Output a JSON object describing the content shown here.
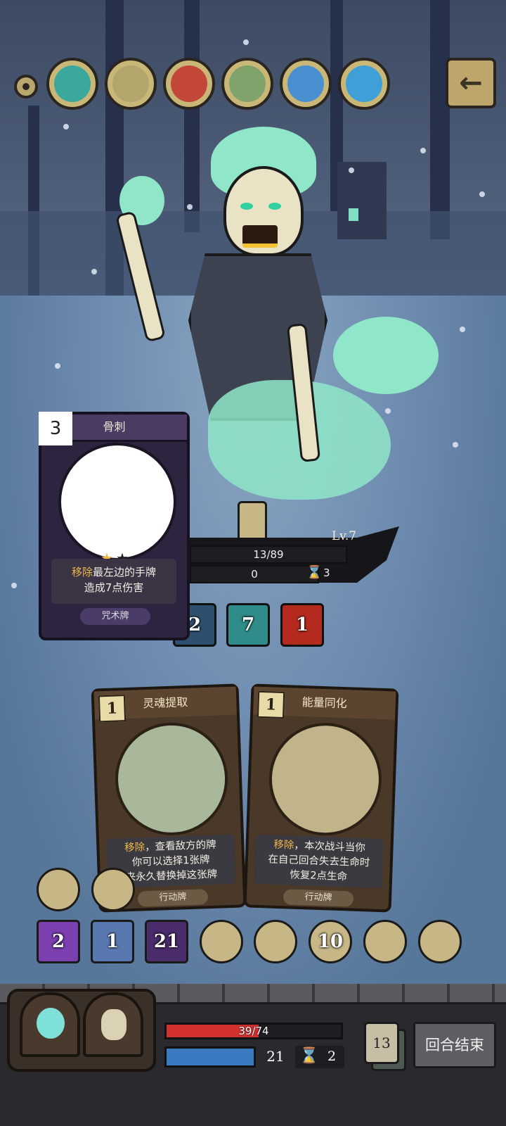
{
  "relic_bar": {
    "relics": [
      {
        "icon": "red-flower-relic-icon",
        "color": "#3aa89c"
      },
      {
        "icon": "fist-relic-icon",
        "color": "#b2a66c"
      },
      {
        "icon": "red-blue-swirl-relic-icon",
        "color": "#c4483a"
      },
      {
        "icon": "green-spirit-relic-icon",
        "color": "#7fa36b"
      },
      {
        "icon": "blue-wind-relic-icon",
        "color": "#4a8fd0"
      },
      {
        "icon": "blue-dragon-relic-icon",
        "color": "#3fa0d8"
      }
    ]
  },
  "enemy": {
    "level": "Lv.7",
    "hp": "13/89",
    "shield": "0",
    "turns": "3",
    "intents": [
      {
        "value": "2",
        "icon": "claw-slash-icon",
        "color": "#2e4f6e"
      },
      {
        "value": "7",
        "icon": "armor-shirt-icon",
        "color": "#2f8c88"
      },
      {
        "value": "1",
        "icon": "red-demon-icon",
        "color": "#b52a1e"
      }
    ]
  },
  "enemy_card": {
    "cost": "3",
    "title": "骨刺",
    "desc_highlight": "移除",
    "desc_line1": "最左边的手牌",
    "desc_line2": "造成7点伤害",
    "type": "咒术牌",
    "stars": 1,
    "stars_max": 2
  },
  "hand": [
    {
      "cost": "1",
      "title": "灵魂提取",
      "hl": "移除",
      "line1": "，查看敌方的牌",
      "line2": "你可以选择1张牌",
      "line3": "来永久替换掉这张牌",
      "type": "行动牌"
    },
    {
      "cost": "1",
      "title": "能量同化",
      "hl": "移除",
      "line1": "，本次战斗当你",
      "line2": "在自己回合失去生命时",
      "line3": "恢复2点生命",
      "type": "行动牌"
    }
  ],
  "buffs": [
    {
      "value": "2",
      "icon": "purple-eye-icon",
      "color": "#7b3fb0"
    },
    {
      "value": "1",
      "icon": "hooded-figure-icon",
      "color": "#5a78b0"
    },
    {
      "value": "21",
      "icon": "purple-shadow-icon",
      "color": "#4a2c6a"
    },
    {
      "value": "",
      "icon": "witch-relic-icon",
      "color": "#c7b787"
    },
    {
      "value": "",
      "icon": "chest-relic-icon",
      "color": "#c7b787"
    },
    {
      "value": "10",
      "icon": "treasure-relic-icon",
      "color": "#c7b787"
    },
    {
      "value": "",
      "icon": "wizard-relic-icon",
      "color": "#c7b787"
    },
    {
      "value": "",
      "icon": "pocket-watch-relic-icon",
      "color": "#c7b787"
    }
  ],
  "player": {
    "hp": "39/74",
    "hp_fraction": 0.527,
    "energy": "21",
    "turns": "2",
    "deck_count": "13",
    "end_turn_label": "回合结束"
  }
}
